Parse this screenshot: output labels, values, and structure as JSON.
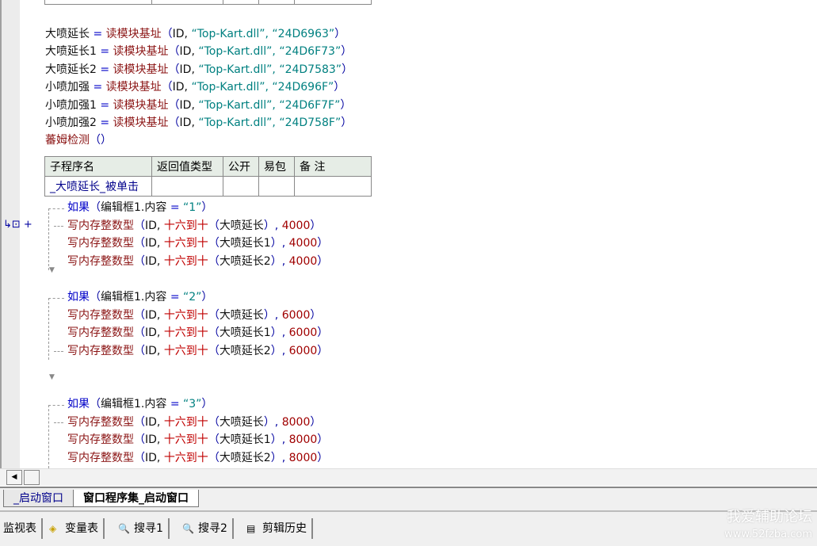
{
  "assignments": [
    [
      {
        "t": "大喷延长 ",
        "c": "text"
      },
      {
        "t": "= ",
        "c": "kw"
      },
      {
        "t": "读模块基址",
        "c": "fn"
      },
      {
        "t": "（",
        "c": "paren"
      },
      {
        "t": "ID, ",
        "c": "text"
      },
      {
        "t": "“Top-Kart.dll”, ",
        "c": "str"
      },
      {
        "t": "“24D6963”",
        "c": "str"
      },
      {
        "t": "）",
        "c": "paren"
      }
    ],
    [
      {
        "t": "大喷延长1 ",
        "c": "text"
      },
      {
        "t": "= ",
        "c": "kw"
      },
      {
        "t": "读模块基址",
        "c": "fn"
      },
      {
        "t": "（",
        "c": "paren"
      },
      {
        "t": "ID, ",
        "c": "text"
      },
      {
        "t": "“Top-Kart.dll”, ",
        "c": "str"
      },
      {
        "t": "“24D6F73”",
        "c": "str"
      },
      {
        "t": "）",
        "c": "paren"
      }
    ],
    [
      {
        "t": "大喷延长2 ",
        "c": "text"
      },
      {
        "t": "= ",
        "c": "kw"
      },
      {
        "t": "读模块基址",
        "c": "fn"
      },
      {
        "t": "（",
        "c": "paren"
      },
      {
        "t": "ID, ",
        "c": "text"
      },
      {
        "t": "“Top-Kart.dll”, ",
        "c": "str"
      },
      {
        "t": "“24D7583”",
        "c": "str"
      },
      {
        "t": "）",
        "c": "paren"
      }
    ],
    [
      {
        "t": "小喷加强 ",
        "c": "text"
      },
      {
        "t": "= ",
        "c": "kw"
      },
      {
        "t": "读模块基址",
        "c": "fn"
      },
      {
        "t": "（",
        "c": "paren"
      },
      {
        "t": "ID, ",
        "c": "text"
      },
      {
        "t": "“Top-Kart.dll”, ",
        "c": "str"
      },
      {
        "t": "“24D696F”",
        "c": "str"
      },
      {
        "t": "）",
        "c": "paren"
      }
    ],
    [
      {
        "t": "小喷加强1 ",
        "c": "text"
      },
      {
        "t": "= ",
        "c": "kw"
      },
      {
        "t": "读模块基址",
        "c": "fn"
      },
      {
        "t": "（",
        "c": "paren"
      },
      {
        "t": "ID, ",
        "c": "text"
      },
      {
        "t": "“Top-Kart.dll”, ",
        "c": "str"
      },
      {
        "t": "“24D6F7F”",
        "c": "str"
      },
      {
        "t": "）",
        "c": "paren"
      }
    ],
    [
      {
        "t": "小喷加强2 ",
        "c": "text"
      },
      {
        "t": "= ",
        "c": "kw"
      },
      {
        "t": "读模块基址",
        "c": "fn"
      },
      {
        "t": "（",
        "c": "paren"
      },
      {
        "t": "ID, ",
        "c": "text"
      },
      {
        "t": "“Top-Kart.dll”, ",
        "c": "str"
      },
      {
        "t": "“24D758F”",
        "c": "str"
      },
      {
        "t": "）",
        "c": "paren"
      }
    ],
    [
      {
        "t": "蕃姆检测",
        "c": "fn"
      },
      {
        "t": "（）",
        "c": "paren"
      }
    ]
  ],
  "sub_table": {
    "headers": [
      "子程序名",
      "返回值类型",
      "公开",
      "易包",
      "备 注"
    ],
    "row": [
      "_大喷延长_被单击",
      "",
      "",
      "",
      ""
    ]
  },
  "blocks": [
    {
      "cond": [
        {
          "t": "如果",
          "c": "kw"
        },
        {
          "t": "（",
          "c": "paren"
        },
        {
          "t": "编辑框1.内容 ",
          "c": "text"
        },
        {
          "t": "= ",
          "c": "kw"
        },
        {
          "t": "“1”",
          "c": "str"
        },
        {
          "t": "）",
          "c": "paren"
        }
      ],
      "body": [
        [
          {
            "t": "写内存整数型",
            "c": "fn"
          },
          {
            "t": "（",
            "c": "paren"
          },
          {
            "t": "ID, ",
            "c": "text"
          },
          {
            "t": "十六到十",
            "c": "hex"
          },
          {
            "t": "（",
            "c": "paren"
          },
          {
            "t": "大喷延长",
            "c": "text"
          },
          {
            "t": "）, ",
            "c": "paren"
          },
          {
            "t": "4000",
            "c": "num"
          },
          {
            "t": "）",
            "c": "paren"
          }
        ],
        [
          {
            "t": "写内存整数型",
            "c": "fn"
          },
          {
            "t": "（",
            "c": "paren"
          },
          {
            "t": "ID, ",
            "c": "text"
          },
          {
            "t": "十六到十",
            "c": "hex"
          },
          {
            "t": "（",
            "c": "paren"
          },
          {
            "t": "大喷延长1",
            "c": "text"
          },
          {
            "t": "）, ",
            "c": "paren"
          },
          {
            "t": "4000",
            "c": "num"
          },
          {
            "t": "）",
            "c": "paren"
          }
        ],
        [
          {
            "t": "写内存整数型",
            "c": "fn"
          },
          {
            "t": "（",
            "c": "paren"
          },
          {
            "t": "ID, ",
            "c": "text"
          },
          {
            "t": "十六到十",
            "c": "hex"
          },
          {
            "t": "（",
            "c": "paren"
          },
          {
            "t": "大喷延长2",
            "c": "text"
          },
          {
            "t": "）, ",
            "c": "paren"
          },
          {
            "t": "4000",
            "c": "num"
          },
          {
            "t": "）",
            "c": "paren"
          }
        ]
      ]
    },
    {
      "cond": [
        {
          "t": "如果",
          "c": "kw"
        },
        {
          "t": "（",
          "c": "paren"
        },
        {
          "t": "编辑框1.内容 ",
          "c": "text"
        },
        {
          "t": "= ",
          "c": "kw"
        },
        {
          "t": "“2”",
          "c": "str"
        },
        {
          "t": "）",
          "c": "paren"
        }
      ],
      "body": [
        [
          {
            "t": "写内存整数型",
            "c": "fn"
          },
          {
            "t": "（",
            "c": "paren"
          },
          {
            "t": "ID, ",
            "c": "text"
          },
          {
            "t": "十六到十",
            "c": "hex"
          },
          {
            "t": "（",
            "c": "paren"
          },
          {
            "t": "大喷延长",
            "c": "text"
          },
          {
            "t": "）, ",
            "c": "paren"
          },
          {
            "t": "6000",
            "c": "num"
          },
          {
            "t": "）",
            "c": "paren"
          }
        ],
        [
          {
            "t": "写内存整数型",
            "c": "fn"
          },
          {
            "t": "（",
            "c": "paren"
          },
          {
            "t": "ID, ",
            "c": "text"
          },
          {
            "t": "十六到十",
            "c": "hex"
          },
          {
            "t": "（",
            "c": "paren"
          },
          {
            "t": "大喷延长1",
            "c": "text"
          },
          {
            "t": "）, ",
            "c": "paren"
          },
          {
            "t": "6000",
            "c": "num"
          },
          {
            "t": "）",
            "c": "paren"
          }
        ],
        [
          {
            "t": "写内存整数型",
            "c": "fn"
          },
          {
            "t": "（",
            "c": "paren"
          },
          {
            "t": "ID, ",
            "c": "text"
          },
          {
            "t": "十六到十",
            "c": "hex"
          },
          {
            "t": "（",
            "c": "paren"
          },
          {
            "t": "大喷延长2",
            "c": "text"
          },
          {
            "t": "）, ",
            "c": "paren"
          },
          {
            "t": "6000",
            "c": "num"
          },
          {
            "t": "）",
            "c": "paren"
          }
        ]
      ]
    },
    {
      "cond": [
        {
          "t": "如果",
          "c": "kw"
        },
        {
          "t": "（",
          "c": "paren"
        },
        {
          "t": "编辑框1.内容 ",
          "c": "text"
        },
        {
          "t": "= ",
          "c": "kw"
        },
        {
          "t": "“3”",
          "c": "str"
        },
        {
          "t": "）",
          "c": "paren"
        }
      ],
      "body": [
        [
          {
            "t": "写内存整数型",
            "c": "fn"
          },
          {
            "t": "（",
            "c": "paren"
          },
          {
            "t": "ID, ",
            "c": "text"
          },
          {
            "t": "十六到十",
            "c": "hex"
          },
          {
            "t": "（",
            "c": "paren"
          },
          {
            "t": "大喷延长",
            "c": "text"
          },
          {
            "t": "）, ",
            "c": "paren"
          },
          {
            "t": "8000",
            "c": "num"
          },
          {
            "t": "）",
            "c": "paren"
          }
        ],
        [
          {
            "t": "写内存整数型",
            "c": "fn"
          },
          {
            "t": "（",
            "c": "paren"
          },
          {
            "t": "ID, ",
            "c": "text"
          },
          {
            "t": "十六到十",
            "c": "hex"
          },
          {
            "t": "（",
            "c": "paren"
          },
          {
            "t": "大喷延长1",
            "c": "text"
          },
          {
            "t": "）, ",
            "c": "paren"
          },
          {
            "t": "8000",
            "c": "num"
          },
          {
            "t": "）",
            "c": "paren"
          }
        ],
        [
          {
            "t": "写内存整数型",
            "c": "fn"
          },
          {
            "t": "（",
            "c": "paren"
          },
          {
            "t": "ID, ",
            "c": "text"
          },
          {
            "t": "十六到十",
            "c": "hex"
          },
          {
            "t": "（",
            "c": "paren"
          },
          {
            "t": "大喷延长2",
            "c": "text"
          },
          {
            "t": "）, ",
            "c": "paren"
          },
          {
            "t": "8000",
            "c": "num"
          },
          {
            "t": "）",
            "c": "paren"
          }
        ]
      ]
    }
  ],
  "gutter_icon": "↳⊡ +",
  "tabs": [
    "_启动窗口",
    "窗口程序集_启动窗口"
  ],
  "tools": [
    {
      "icon": "",
      "label": "监视表"
    },
    {
      "icon": "◈",
      "label": "变量表"
    },
    {
      "icon": "🔍",
      "label": "搜寻1"
    },
    {
      "icon": "🔍",
      "label": "搜寻2"
    },
    {
      "icon": "▤",
      "label": "剪辑历史"
    }
  ],
  "watermark": {
    "title": "我爱辅助论坛",
    "url": "www.52fzba.com"
  }
}
